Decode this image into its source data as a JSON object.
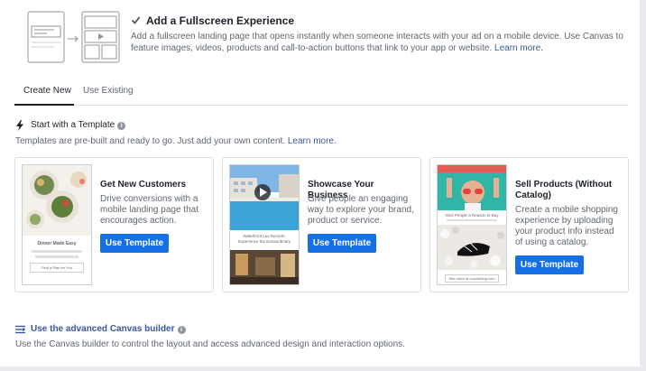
{
  "fullscreen": {
    "checked": true,
    "title": "Add a Fullscreen Experience",
    "description": "Add a fullscreen landing page that opens instantly when someone interacts with your ad on a mobile device. Use Canvas to feature images, videos, products and call-to-action buttons that link to your app or website.",
    "learn_more": "Learn more."
  },
  "tabs": [
    {
      "label": "Create New",
      "active": true
    },
    {
      "label": "Use Existing",
      "active": false
    }
  ],
  "template_section": {
    "title": "Start with a Template",
    "description": "Templates are pre-built and ready to go. Just add your own content.",
    "learn_more": "Learn more."
  },
  "cards": [
    {
      "title": "Get New Customers",
      "description": "Drive conversions with a mobile landing page that encourages action.",
      "button": "Use Template",
      "thumb_caption": "Dinner Made Easy",
      "thumb_button": "Find a Plan for You"
    },
    {
      "title": "Showcase Your Business",
      "description": "Give people an engaging way to explore your brand, product or service.",
      "button": "Use Template",
      "thumb_caption": "Waterfront Lux Resorts: Experience the Extraordinary"
    },
    {
      "title": "Sell Products (Without Catalog)",
      "description": "Create a mobile shopping experience by uploading your product info instead of using a catalog.",
      "button": "Use Template",
      "thumb_caption": "Give People a Reason to Buy",
      "thumb_button": "See more at ourclothing.com"
    }
  ],
  "advanced": {
    "title": "Use the advanced Canvas builder",
    "description": "Use the Canvas builder to control the layout and access advanced design and interaction options."
  },
  "colors": {
    "button_blue": "#166fe5",
    "link_blue": "#385898",
    "text_primary": "#1d2129",
    "text_secondary": "#606770"
  }
}
